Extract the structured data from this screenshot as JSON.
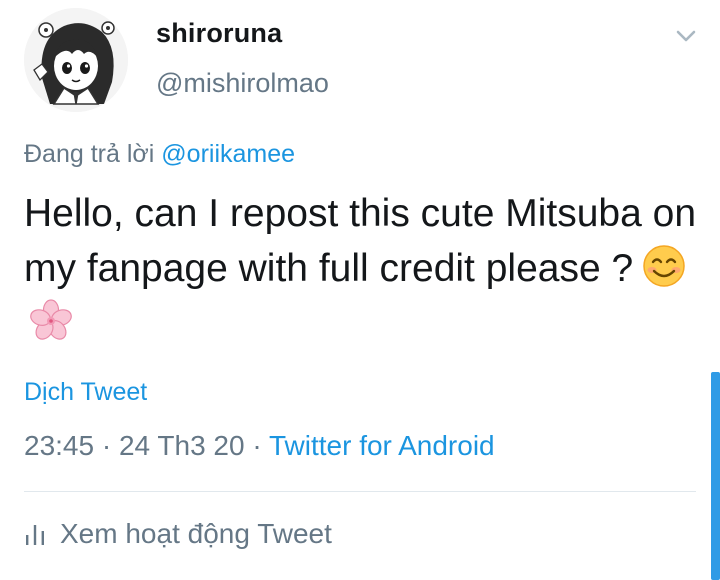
{
  "author": {
    "display_name": "shiroruna",
    "handle": "@mishirolmao"
  },
  "reply": {
    "prefix": "Đang trả lời ",
    "mention": "@oriikamee"
  },
  "tweet": {
    "text": "Hello, can I repost this cute Mitsuba on my fanpage with full credit please ?",
    "emojis": [
      "smiling-face-emoji",
      "cherry-blossom-emoji"
    ]
  },
  "translate_label": "Dịch Tweet",
  "meta": {
    "time": "23:45",
    "separator": " · ",
    "date": "24 Th3 20",
    "source": "Twitter for Android"
  },
  "activity_label": "Xem hoạt động Tweet",
  "icons": {
    "menu": "chevron-down-icon",
    "activity": "bar-chart-icon"
  },
  "colors": {
    "link": "#1b95e0",
    "muted": "#657786",
    "text": "#14171a",
    "divider": "#e1e8ed",
    "scrollbar": "#2f9be6"
  }
}
